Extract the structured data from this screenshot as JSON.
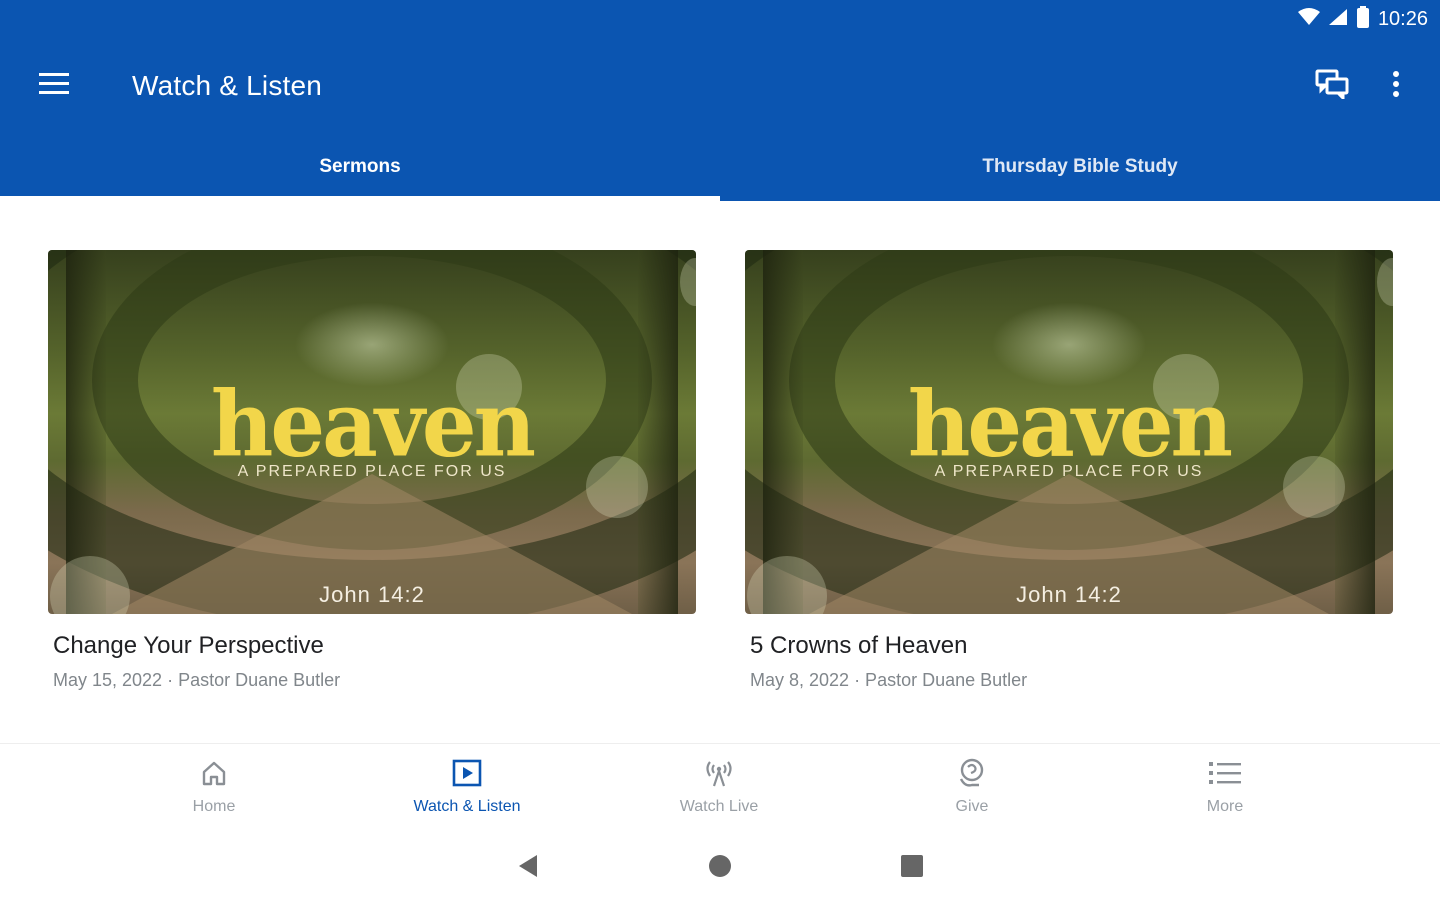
{
  "status_bar": {
    "time": "10:26",
    "icons": [
      "wifi-icon",
      "cellular-signal-icon",
      "battery-icon"
    ]
  },
  "app_bar": {
    "title": "Watch & Listen",
    "menu_icon": "menu-icon",
    "actions": [
      "chat-icon",
      "overflow-menu-icon"
    ]
  },
  "tabs": [
    {
      "label": "Sermons",
      "selected": true
    },
    {
      "label": "Thursday Bible Study",
      "selected": false
    }
  ],
  "sermons": [
    {
      "title": "Change Your Perspective",
      "meta": "May 15, 2022 · Pastor Duane Butler",
      "artwork": {
        "headline": "heaven",
        "subtitle": "A PREPARED PLACE FOR US",
        "verse": "John 14:2"
      }
    },
    {
      "title": "5 Crowns of Heaven",
      "meta": "May 8, 2022 · Pastor Duane Butler",
      "artwork": {
        "headline": "heaven",
        "subtitle": "A PREPARED PLACE FOR US",
        "verse": "John 14:2"
      }
    }
  ],
  "bottom_nav": [
    {
      "label": "Home",
      "icon": "home-icon",
      "active": false
    },
    {
      "label": "Watch & Listen",
      "icon": "play-icon",
      "active": true
    },
    {
      "label": "Watch Live",
      "icon": "broadcast-icon",
      "active": false
    },
    {
      "label": "Give",
      "icon": "give-icon",
      "active": false
    },
    {
      "label": "More",
      "icon": "list-icon",
      "active": false
    }
  ],
  "system_nav": [
    "back-icon",
    "home-circle-icon",
    "recents-icon"
  ],
  "colors": {
    "primary": "#0b55b1",
    "artwork_title": "#f2d64a",
    "text_primary": "#202124",
    "text_secondary": "#80868b",
    "nav_inactive": "#9aa0a6"
  }
}
